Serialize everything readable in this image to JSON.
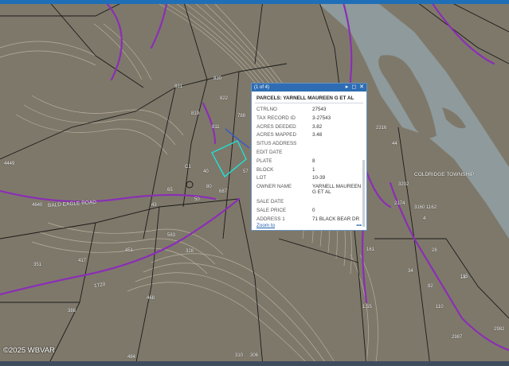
{
  "popup": {
    "counter": "(1 of 4)",
    "title": "PARCELS: YARNELL MAUREEN G ET AL",
    "fields": [
      {
        "key": "CTRLNO",
        "value": "27543"
      },
      {
        "key": "TAX RECORD ID",
        "value": "3-27543"
      },
      {
        "key": "ACRES DEEDED",
        "value": "3.82"
      },
      {
        "key": "ACRES MAPPED",
        "value": "3.48"
      },
      {
        "key": "SITUS ADDRESS",
        "value": ""
      },
      {
        "key": "EDIT DATE",
        "value": ""
      },
      {
        "key": "PLATE",
        "value": "8"
      },
      {
        "key": "BLOCK",
        "value": "1"
      },
      {
        "key": "LOT",
        "value": "10-39"
      },
      {
        "key": "OWNER NAME",
        "value": "YARNELL MAUREEN G ET AL"
      },
      {
        "key": "SALE DATE",
        "value": ""
      },
      {
        "key": "SALE PRICE",
        "value": "0"
      },
      {
        "key": "ADDRESS 1",
        "value": "71 BLACK BEAR DR"
      }
    ],
    "zoom_label": "Zoom to",
    "more_label": "•••",
    "icons": [
      "play-icon",
      "maximize-icon",
      "close-icon"
    ]
  },
  "map": {
    "parcel_labels": [
      "830",
      "831",
      "822",
      "819",
      "788",
      "811",
      "C1",
      "40",
      "80",
      "57",
      "50",
      "687",
      "65",
      "43",
      "583",
      "328",
      "4449",
      "4640",
      "351",
      "417",
      "451",
      "468",
      "388",
      "484",
      "310",
      "306",
      "2316",
      "44",
      "3202",
      "3160",
      "1162",
      "2174",
      "4",
      "161",
      "28",
      "34",
      "82",
      "115",
      "110",
      "2987",
      "2982",
      "18",
      "1.55"
    ],
    "road_labels": [
      "BALD EAGLE ROAD",
      "COLDRIDGE TOWNSHIP",
      "1720"
    ],
    "colors": {
      "terrain": "#7e786a",
      "river": "#8e9a9b",
      "parcel_line": "#1a1a1a",
      "contour": "#c8c2b0",
      "road": "#8a2fb5",
      "selected": "#1ee0d6",
      "highlight": "#2e58d8"
    }
  },
  "copyright": "©2025 WBVAR"
}
